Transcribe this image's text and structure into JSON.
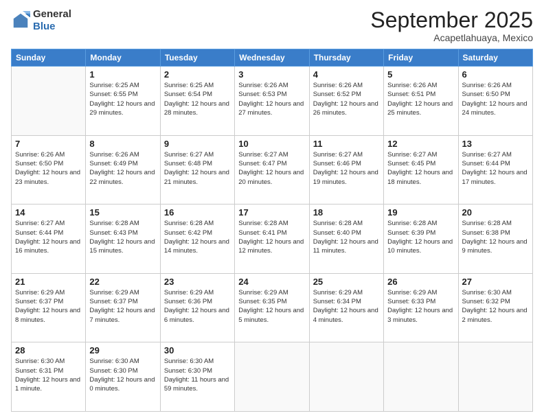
{
  "logo": {
    "general": "General",
    "blue": "Blue"
  },
  "header": {
    "month": "September 2025",
    "location": "Acapetlahuaya, Mexico"
  },
  "weekdays": [
    "Sunday",
    "Monday",
    "Tuesday",
    "Wednesday",
    "Thursday",
    "Friday",
    "Saturday"
  ],
  "weeks": [
    [
      {
        "day": null,
        "sunrise": "",
        "sunset": "",
        "daylight": ""
      },
      {
        "day": "1",
        "sunrise": "Sunrise: 6:25 AM",
        "sunset": "Sunset: 6:55 PM",
        "daylight": "Daylight: 12 hours and 29 minutes."
      },
      {
        "day": "2",
        "sunrise": "Sunrise: 6:25 AM",
        "sunset": "Sunset: 6:54 PM",
        "daylight": "Daylight: 12 hours and 28 minutes."
      },
      {
        "day": "3",
        "sunrise": "Sunrise: 6:26 AM",
        "sunset": "Sunset: 6:53 PM",
        "daylight": "Daylight: 12 hours and 27 minutes."
      },
      {
        "day": "4",
        "sunrise": "Sunrise: 6:26 AM",
        "sunset": "Sunset: 6:52 PM",
        "daylight": "Daylight: 12 hours and 26 minutes."
      },
      {
        "day": "5",
        "sunrise": "Sunrise: 6:26 AM",
        "sunset": "Sunset: 6:51 PM",
        "daylight": "Daylight: 12 hours and 25 minutes."
      },
      {
        "day": "6",
        "sunrise": "Sunrise: 6:26 AM",
        "sunset": "Sunset: 6:50 PM",
        "daylight": "Daylight: 12 hours and 24 minutes."
      }
    ],
    [
      {
        "day": "7",
        "sunrise": "Sunrise: 6:26 AM",
        "sunset": "Sunset: 6:50 PM",
        "daylight": "Daylight: 12 hours and 23 minutes."
      },
      {
        "day": "8",
        "sunrise": "Sunrise: 6:26 AM",
        "sunset": "Sunset: 6:49 PM",
        "daylight": "Daylight: 12 hours and 22 minutes."
      },
      {
        "day": "9",
        "sunrise": "Sunrise: 6:27 AM",
        "sunset": "Sunset: 6:48 PM",
        "daylight": "Daylight: 12 hours and 21 minutes."
      },
      {
        "day": "10",
        "sunrise": "Sunrise: 6:27 AM",
        "sunset": "Sunset: 6:47 PM",
        "daylight": "Daylight: 12 hours and 20 minutes."
      },
      {
        "day": "11",
        "sunrise": "Sunrise: 6:27 AM",
        "sunset": "Sunset: 6:46 PM",
        "daylight": "Daylight: 12 hours and 19 minutes."
      },
      {
        "day": "12",
        "sunrise": "Sunrise: 6:27 AM",
        "sunset": "Sunset: 6:45 PM",
        "daylight": "Daylight: 12 hours and 18 minutes."
      },
      {
        "day": "13",
        "sunrise": "Sunrise: 6:27 AM",
        "sunset": "Sunset: 6:44 PM",
        "daylight": "Daylight: 12 hours and 17 minutes."
      }
    ],
    [
      {
        "day": "14",
        "sunrise": "Sunrise: 6:27 AM",
        "sunset": "Sunset: 6:44 PM",
        "daylight": "Daylight: 12 hours and 16 minutes."
      },
      {
        "day": "15",
        "sunrise": "Sunrise: 6:28 AM",
        "sunset": "Sunset: 6:43 PM",
        "daylight": "Daylight: 12 hours and 15 minutes."
      },
      {
        "day": "16",
        "sunrise": "Sunrise: 6:28 AM",
        "sunset": "Sunset: 6:42 PM",
        "daylight": "Daylight: 12 hours and 14 minutes."
      },
      {
        "day": "17",
        "sunrise": "Sunrise: 6:28 AM",
        "sunset": "Sunset: 6:41 PM",
        "daylight": "Daylight: 12 hours and 12 minutes."
      },
      {
        "day": "18",
        "sunrise": "Sunrise: 6:28 AM",
        "sunset": "Sunset: 6:40 PM",
        "daylight": "Daylight: 12 hours and 11 minutes."
      },
      {
        "day": "19",
        "sunrise": "Sunrise: 6:28 AM",
        "sunset": "Sunset: 6:39 PM",
        "daylight": "Daylight: 12 hours and 10 minutes."
      },
      {
        "day": "20",
        "sunrise": "Sunrise: 6:28 AM",
        "sunset": "Sunset: 6:38 PM",
        "daylight": "Daylight: 12 hours and 9 minutes."
      }
    ],
    [
      {
        "day": "21",
        "sunrise": "Sunrise: 6:29 AM",
        "sunset": "Sunset: 6:37 PM",
        "daylight": "Daylight: 12 hours and 8 minutes."
      },
      {
        "day": "22",
        "sunrise": "Sunrise: 6:29 AM",
        "sunset": "Sunset: 6:37 PM",
        "daylight": "Daylight: 12 hours and 7 minutes."
      },
      {
        "day": "23",
        "sunrise": "Sunrise: 6:29 AM",
        "sunset": "Sunset: 6:36 PM",
        "daylight": "Daylight: 12 hours and 6 minutes."
      },
      {
        "day": "24",
        "sunrise": "Sunrise: 6:29 AM",
        "sunset": "Sunset: 6:35 PM",
        "daylight": "Daylight: 12 hours and 5 minutes."
      },
      {
        "day": "25",
        "sunrise": "Sunrise: 6:29 AM",
        "sunset": "Sunset: 6:34 PM",
        "daylight": "Daylight: 12 hours and 4 minutes."
      },
      {
        "day": "26",
        "sunrise": "Sunrise: 6:29 AM",
        "sunset": "Sunset: 6:33 PM",
        "daylight": "Daylight: 12 hours and 3 minutes."
      },
      {
        "day": "27",
        "sunrise": "Sunrise: 6:30 AM",
        "sunset": "Sunset: 6:32 PM",
        "daylight": "Daylight: 12 hours and 2 minutes."
      }
    ],
    [
      {
        "day": "28",
        "sunrise": "Sunrise: 6:30 AM",
        "sunset": "Sunset: 6:31 PM",
        "daylight": "Daylight: 12 hours and 1 minute."
      },
      {
        "day": "29",
        "sunrise": "Sunrise: 6:30 AM",
        "sunset": "Sunset: 6:30 PM",
        "daylight": "Daylight: 12 hours and 0 minutes."
      },
      {
        "day": "30",
        "sunrise": "Sunrise: 6:30 AM",
        "sunset": "Sunset: 6:30 PM",
        "daylight": "Daylight: 11 hours and 59 minutes."
      },
      {
        "day": null,
        "sunrise": "",
        "sunset": "",
        "daylight": ""
      },
      {
        "day": null,
        "sunrise": "",
        "sunset": "",
        "daylight": ""
      },
      {
        "day": null,
        "sunrise": "",
        "sunset": "",
        "daylight": ""
      },
      {
        "day": null,
        "sunrise": "",
        "sunset": "",
        "daylight": ""
      }
    ]
  ]
}
